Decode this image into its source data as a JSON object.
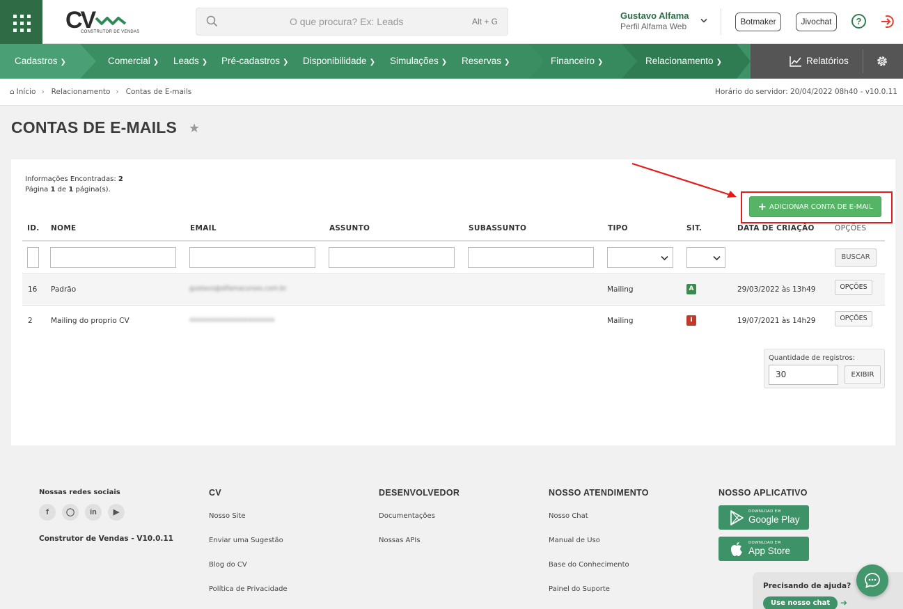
{
  "header": {
    "logo_text": "CV",
    "logo_subtitle": "CONSTRUTOR DE VENDAS",
    "search_placeholder": "O que procura? Ex: Leads",
    "search_shortcut": "Alt + G",
    "user_name": "Gustavo Alfama",
    "user_profile": "Perfil Alfama Web",
    "botmaker_label": "Botmaker",
    "jivochat_label": "Jivochat"
  },
  "nav": {
    "items": [
      "Cadastros",
      "Comercial",
      "Leads",
      "Pré-cadastros",
      "Disponibilidade",
      "Simulações",
      "Reservas",
      "Financeiro",
      "Relacionamento"
    ],
    "reports_label": "Relatórios"
  },
  "breadcrumb": [
    "Início",
    "Relacionamento",
    "Contas de E-mails"
  ],
  "server_time": "Horário do servidor: 20/04/2022 08h40 - v10.0.11",
  "page_title": "CONTAS DE E-MAILS",
  "info": {
    "found_label": "Informações Encontradas:",
    "found_count": "2",
    "page_prefix": "Página",
    "page_current": "1",
    "page_of": "de",
    "page_total": "1",
    "page_suffix": "página(s)."
  },
  "add_button_label": "ADICIONAR CONTA DE E-MAIL",
  "table": {
    "columns": [
      "ID.",
      "NOME",
      "EMAIL",
      "ASSUNTO",
      "SUBASSUNTO",
      "TIPO",
      "SIT.",
      "DATA DE CRIAÇÃO",
      "OPÇÕES"
    ],
    "search_button": "BUSCAR",
    "rows": [
      {
        "id": "16",
        "nome": "Padrão",
        "email": "gustavo@alfamacursos.com.br",
        "assunto": "",
        "subassunto": "",
        "tipo": "Mailing",
        "sit": "A",
        "sit_color": "#3c8a4f",
        "data": "29/03/2022 às 13h49",
        "opcoes": "OPÇÕES"
      },
      {
        "id": "2",
        "nome": "Mailing do proprio CV",
        "email": "xxxxxxxxxxxxxxxxxxxxxxx",
        "assunto": "",
        "subassunto": "",
        "tipo": "Mailing",
        "sit": "I",
        "sit_color": "#c0392b",
        "data": "19/07/2021 às 14h29",
        "opcoes": "OPÇÕES"
      }
    ]
  },
  "records": {
    "label": "Quantidade de registros:",
    "value": "30",
    "button": "EXIBIR"
  },
  "footer": {
    "social_title": "Nossas redes sociais",
    "version": "Construtor de Vendas - V10.0.11",
    "cv_title": "CV",
    "cv_links": [
      "Nosso Site",
      "Enviar uma Sugestão",
      "Blog do CV",
      "Política de Privacidade"
    ],
    "dev_title": "DESENVOLVEDOR",
    "dev_links": [
      "Documentações",
      "Nossas APIs"
    ],
    "support_title": "NOSSO ATENDIMENTO",
    "support_links": [
      "Nosso Chat",
      "Manual de Uso",
      "Base do Conhecimento",
      "Painel do Suporte"
    ],
    "app_title": "NOSSO APLICATIVO",
    "google_small": "DOWNLOAD EM",
    "google_big": "Google Play",
    "apple_small": "DOWNLOAD EM",
    "apple_big": "App Store"
  },
  "help": {
    "question": "Precisando de ajuda?",
    "chat_button": "Use nosso chat"
  },
  "colors": {
    "brand_green": "#3f9268",
    "dark_green": "#2f6b45",
    "add_button": "#56b466",
    "highlight_red": "#e31b1b"
  }
}
